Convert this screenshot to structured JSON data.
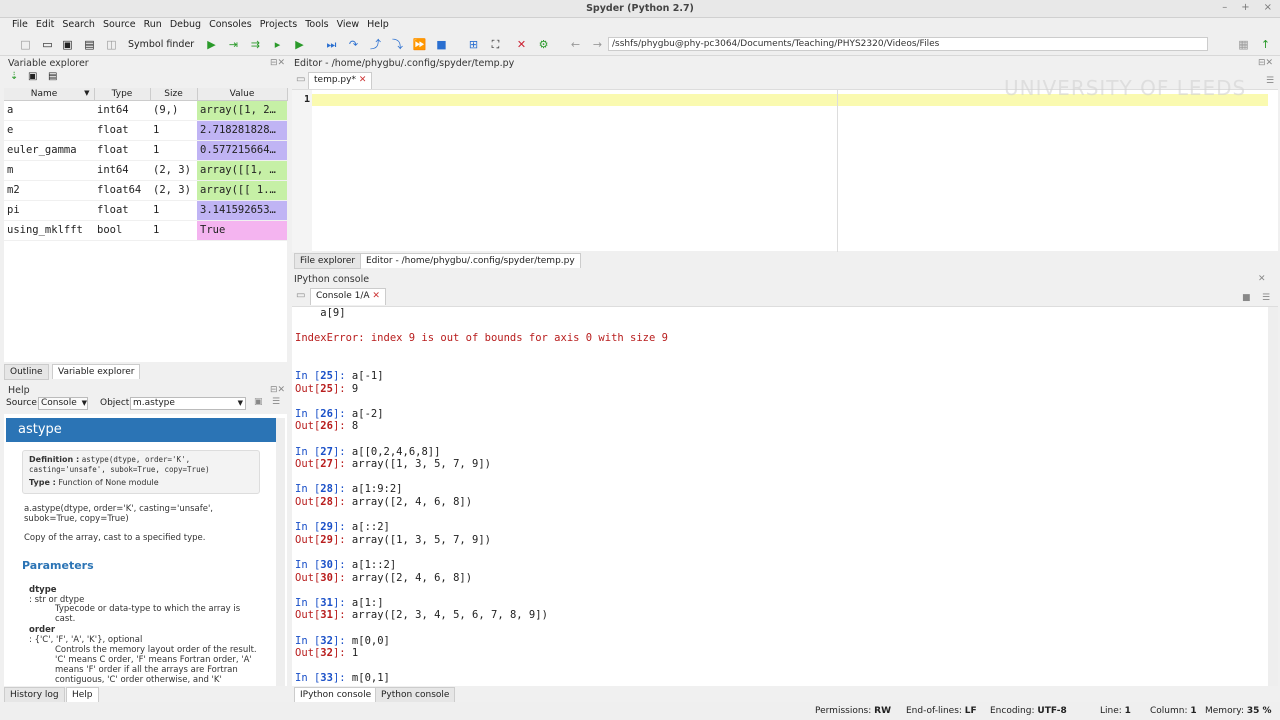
{
  "window": {
    "title": "Spyder (Python 2.7)",
    "controls": [
      "–",
      "+",
      "×"
    ]
  },
  "menu": [
    "File",
    "Edit",
    "Search",
    "Source",
    "Run",
    "Debug",
    "Consoles",
    "Projects",
    "Tools",
    "View",
    "Help"
  ],
  "toolbar": {
    "symbol_finder": "Symbol finder",
    "path": "/sshfs/phygbu@phy-pc3064/Documents/Teaching/PHYS2320/Videos/Files"
  },
  "variable_explorer": {
    "title": "Variable explorer",
    "columns": [
      "Name",
      "Type",
      "Size",
      "Value"
    ],
    "rows": [
      {
        "name": "a",
        "type": "int64",
        "size": "(9,)",
        "value": "array([1, 2…",
        "color": "#c6f0a6"
      },
      {
        "name": "e",
        "type": "float",
        "size": "1",
        "value": "2.718281828…",
        "color": "#c0b4f4"
      },
      {
        "name": "euler_gamma",
        "type": "float",
        "size": "1",
        "value": "0.577215664…",
        "color": "#c0b4f4"
      },
      {
        "name": "m",
        "type": "int64",
        "size": "(2, 3)",
        "value": "array([[1, …",
        "color": "#c6f0a6"
      },
      {
        "name": "m2",
        "type": "float64",
        "size": "(2, 3)",
        "value": "array([[ 1.…",
        "color": "#c6f0a6"
      },
      {
        "name": "pi",
        "type": "float",
        "size": "1",
        "value": "3.141592653…",
        "color": "#c0b4f4"
      },
      {
        "name": "using_mklfft",
        "type": "bool",
        "size": "1",
        "value": "True",
        "color": "#f4b4f0"
      }
    ],
    "tabs": [
      "Outline",
      "Variable explorer"
    ]
  },
  "help": {
    "title": "Help",
    "source_label": "Source",
    "source_value": "Console",
    "object_label": "Object",
    "object_value": "m.astype",
    "heading": "astype",
    "definition_label": "Definition :",
    "definition": "astype(dtype, order='K', casting='unsafe', subok=True, copy=True)",
    "type_label": "Type :",
    "type_value": "Function of None module",
    "signature": "a.astype(dtype, order='K', casting='unsafe', subok=True, copy=True)",
    "summary": "Copy of the array, cast to a specified type.",
    "parameters_heading": "Parameters",
    "p1_name": "dtype",
    "p1_type": ": str or dtype",
    "p1_desc": "Typecode or data-type to which the array is cast.",
    "p2_name": "order",
    "p2_type": ": {'C', 'F', 'A', 'K'}, optional",
    "p2_desc": "Controls the memory layout order of the result. 'C' means C order, 'F' means Fortran order, 'A' means 'F' order if all the arrays are Fortran contiguous, 'C' order otherwise, and 'K'",
    "tabs": [
      "History log",
      "Help"
    ]
  },
  "editor": {
    "title": "Editor - /home/phygbu/.config/spyder/temp.py",
    "tab": "temp.py*",
    "line_number": "1",
    "watermark": "UNIVERSITY OF LEEDS",
    "bottom_tabs": [
      "File explorer",
      "Editor - /home/phygbu/.config/spyder/temp.py"
    ]
  },
  "console": {
    "title": "IPython console",
    "tab": "Console 1/A",
    "lines": [
      {
        "kind": "plain",
        "text": "    a[9]"
      },
      {
        "kind": "blank"
      },
      {
        "kind": "err",
        "text": "IndexError: index 9 is out of bounds for axis 0 with size 9"
      },
      {
        "kind": "blank"
      },
      {
        "kind": "blank"
      },
      {
        "kind": "in",
        "n": "25",
        "code": "a[-1]"
      },
      {
        "kind": "out",
        "n": "25",
        "code": "9"
      },
      {
        "kind": "blank"
      },
      {
        "kind": "in",
        "n": "26",
        "code": "a[-2]"
      },
      {
        "kind": "out",
        "n": "26",
        "code": "8"
      },
      {
        "kind": "blank"
      },
      {
        "kind": "in",
        "n": "27",
        "code": "a[[0,2,4,6,8]]"
      },
      {
        "kind": "out",
        "n": "27",
        "code": "array([1, 3, 5, 7, 9])"
      },
      {
        "kind": "blank"
      },
      {
        "kind": "in",
        "n": "28",
        "code": "a[1:9:2]"
      },
      {
        "kind": "out",
        "n": "28",
        "code": "array([2, 4, 6, 8])"
      },
      {
        "kind": "blank"
      },
      {
        "kind": "in",
        "n": "29",
        "code": "a[::2]"
      },
      {
        "kind": "out",
        "n": "29",
        "code": "array([1, 3, 5, 7, 9])"
      },
      {
        "kind": "blank"
      },
      {
        "kind": "in",
        "n": "30",
        "code": "a[1::2]"
      },
      {
        "kind": "out",
        "n": "30",
        "code": "array([2, 4, 6, 8])"
      },
      {
        "kind": "blank"
      },
      {
        "kind": "in",
        "n": "31",
        "code": "a[1:]"
      },
      {
        "kind": "out",
        "n": "31",
        "code": "array([2, 3, 4, 5, 6, 7, 8, 9])"
      },
      {
        "kind": "blank"
      },
      {
        "kind": "in",
        "n": "32",
        "code": "m[0,0]"
      },
      {
        "kind": "out",
        "n": "32",
        "code": "1"
      },
      {
        "kind": "blank"
      },
      {
        "kind": "in",
        "n": "33",
        "code": "m[0,1]"
      }
    ],
    "bottom_tabs": [
      "IPython console",
      "Python console"
    ]
  },
  "status": {
    "permissions_label": "Permissions:",
    "permissions": "RW",
    "eol_label": "End-of-lines:",
    "eol": "LF",
    "encoding_label": "Encoding:",
    "encoding": "UTF-8",
    "line_label": "Line:",
    "line": "1",
    "column_label": "Column:",
    "column": "1",
    "memory_label": "Memory:",
    "memory": "35 %"
  }
}
